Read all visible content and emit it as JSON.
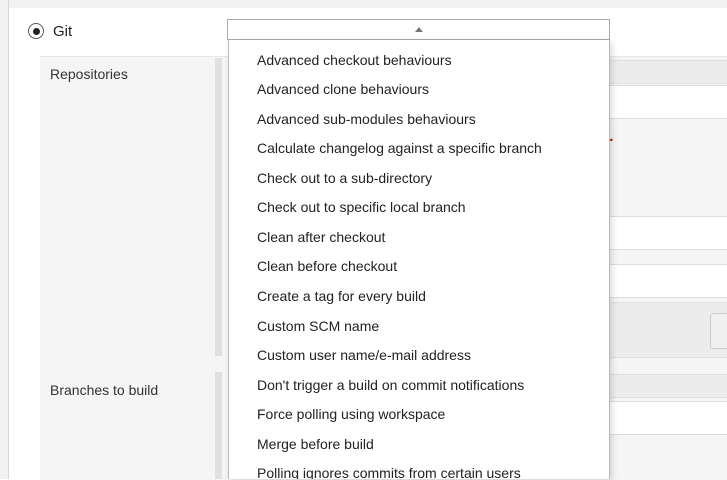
{
  "scm": {
    "option_label": "Git",
    "selected": true
  },
  "labels": {
    "repositories": "Repositories",
    "branches": "Branches to build"
  },
  "error_fragment": "y.",
  "dropdown": {
    "items": [
      "Advanced checkout behaviours",
      "Advanced clone behaviours",
      "Advanced sub-modules behaviours",
      "Calculate changelog against a specific branch",
      "Check out to a sub-directory",
      "Check out to specific local branch",
      "Clean after checkout",
      "Clean before checkout",
      "Create a tag for every build",
      "Custom SCM name",
      "Custom user name/e-mail address",
      "Don't trigger a build on commit notifications",
      "Force polling using workspace",
      "Merge before build",
      "Polling ignores commits from certain users"
    ]
  },
  "colors": {
    "error": "#cc0000",
    "section_bg": "#f5f5f5"
  }
}
